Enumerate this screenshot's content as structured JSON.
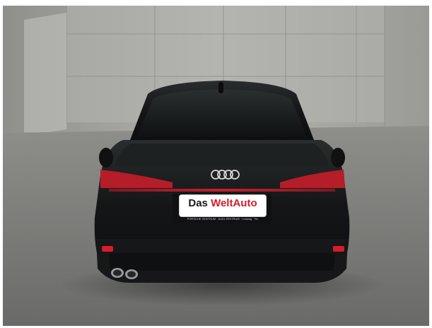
{
  "photo": {
    "subject": "car-rear-view",
    "plate": {
      "part1": "Das",
      "part2": "WeltAuto",
      "fineprint": "PORSCHE ZENTRUM · AUDI ZENTRUM · Leasing · Fin"
    },
    "colors": {
      "wall": "#a9a9a6",
      "floor": "#7d7d7b",
      "car_body": "#141617",
      "taillight": "#c4202c",
      "accent_red": "#d81b2a"
    }
  }
}
